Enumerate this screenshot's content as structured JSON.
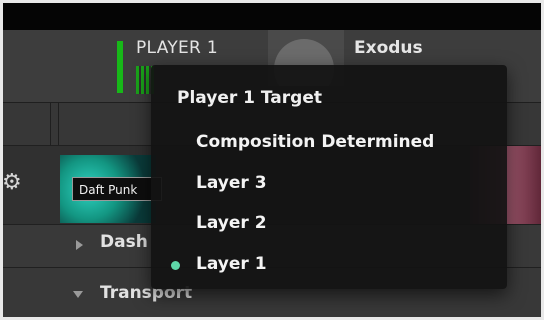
{
  "header": {
    "player_label": "PLAYER 1",
    "deck_name": "Exodus"
  },
  "layer": {
    "clip_name": "Daft Punk",
    "groups": [
      {
        "label": "Dashboard",
        "visible_text": "Dash",
        "expanded": false
      },
      {
        "label": "Transport",
        "visible_text": "Transport",
        "expanded": true
      }
    ]
  },
  "menu": {
    "title": "Player 1 Target",
    "items": [
      {
        "label": "Composition Determined",
        "selected": false
      },
      {
        "label": "Layer 3",
        "selected": false
      },
      {
        "label": "Layer 2",
        "selected": false
      },
      {
        "label": "Layer 1",
        "selected": true
      }
    ],
    "selected_color": "#5ed6a8"
  },
  "colors": {
    "meter_green": "#17b818",
    "panel_bg": "#3d3d3d"
  }
}
